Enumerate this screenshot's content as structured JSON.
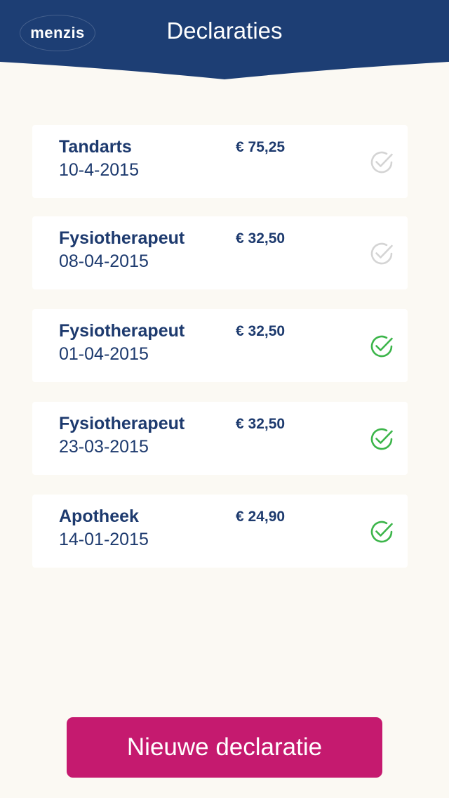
{
  "header": {
    "logo_text": "menzis",
    "title": "Declaraties",
    "background": "#1d3e74"
  },
  "declarations": [
    {
      "name": "Tandarts",
      "date": "10-4-2015",
      "amount": "€ 75,25",
      "status": "pending",
      "icon": "check-circle-icon"
    },
    {
      "name": "Fysiotherapeut",
      "date": "08-04-2015",
      "amount": "€ 32,50",
      "status": "pending",
      "icon": "check-circle-icon"
    },
    {
      "name": "Fysiotherapeut",
      "date": "01-04-2015",
      "amount": "€ 32,50",
      "status": "approved",
      "icon": "check-circle-icon"
    },
    {
      "name": "Fysiotherapeut",
      "date": "23-03-2015",
      "amount": "€ 32,50",
      "status": "approved",
      "icon": "check-circle-icon"
    },
    {
      "name": "Apotheek",
      "date": "14-01-2015",
      "amount": "€ 24,90",
      "status": "approved",
      "icon": "check-circle-icon"
    }
  ],
  "colors": {
    "pending": "#d4d4d4",
    "approved": "#3cb54a",
    "accent": "#c51a6f",
    "text": "#1d3a6e"
  },
  "new_button": {
    "label": "Nieuwe declaratie"
  }
}
